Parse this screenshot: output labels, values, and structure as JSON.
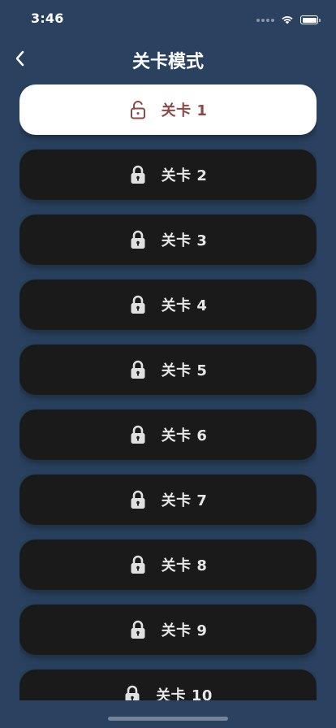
{
  "status": {
    "time": "3:46"
  },
  "nav": {
    "title": "关卡模式"
  },
  "levels": [
    {
      "label": "关卡 1",
      "state": "unlocked"
    },
    {
      "label": "关卡 2",
      "state": "locked"
    },
    {
      "label": "关卡 3",
      "state": "locked"
    },
    {
      "label": "关卡 4",
      "state": "locked"
    },
    {
      "label": "关卡 5",
      "state": "locked"
    },
    {
      "label": "关卡 6",
      "state": "locked"
    },
    {
      "label": "关卡 7",
      "state": "locked"
    },
    {
      "label": "关卡 8",
      "state": "locked"
    },
    {
      "label": "关卡 9",
      "state": "locked"
    },
    {
      "label": "关卡 10",
      "state": "locked"
    }
  ],
  "colors": {
    "background": "#2a4260",
    "item_locked": "#1a1a1a",
    "item_selected": "#ffffff",
    "selected_text": "#8a4a48"
  }
}
